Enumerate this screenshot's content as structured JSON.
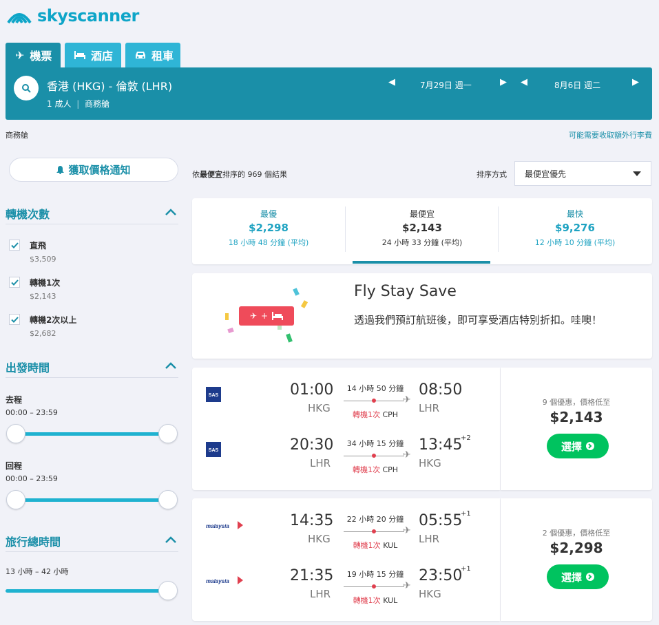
{
  "brand": {
    "name": "skyscanner"
  },
  "tabs": [
    {
      "label": "機票",
      "icon": "plane-icon"
    },
    {
      "label": "酒店",
      "icon": "bed-icon"
    },
    {
      "label": "租車",
      "icon": "car-icon"
    }
  ],
  "search": {
    "route": "香港 (HKG) - 倫敦 (LHR)",
    "passengers": "1 成人",
    "cabin": "商務艙",
    "depart_date": "7月29日 週一",
    "return_date": "8月6日 週二"
  },
  "subheader": {
    "cabin": "商務艙",
    "baggage_link": "可能需要收取額外行李費"
  },
  "sidebar": {
    "alert_button": "獲取價格通知",
    "stops": {
      "title": "轉機次數",
      "options": [
        {
          "label": "直飛",
          "price": "$3,509"
        },
        {
          "label": "轉機1次",
          "price": "$2,143"
        },
        {
          "label": "轉機2次以上",
          "price": "$2,682"
        }
      ]
    },
    "departure_time": {
      "title": "出發時間",
      "outbound_label": "去程",
      "outbound_range": "00:00 – 23:59",
      "return_label": "回程",
      "return_range": "00:00 – 23:59"
    },
    "duration": {
      "title": "旅行總時間",
      "range": "13 小時 – 42 小時"
    }
  },
  "results": {
    "count_prefix": "依",
    "count_bold": "最便宜",
    "count_suffix": "排序的 969 個結果",
    "sort_label": "排序方式",
    "sort_value": "最便宜優先"
  },
  "summary": [
    {
      "label": "最優",
      "price": "$2,298",
      "avg": "18 小時 48 分鐘 (平均)"
    },
    {
      "label": "最便宜",
      "price": "$2,143",
      "avg": "24 小時 33 分鐘 (平均)"
    },
    {
      "label": "最快",
      "price": "$9,276",
      "avg": "12 小時 10 分鐘 (平均)"
    }
  ],
  "promo": {
    "title": "Fly Stay Save",
    "text": "透過我們預訂航班後，即可享受酒店特別折扣。哇噢！",
    "badge_plus": "+"
  },
  "flights": [
    {
      "airline": "SAS",
      "legs": [
        {
          "dep_time": "01:00",
          "dep_code": "HKG",
          "duration": "14 小時 50 分鐘",
          "stops": "轉機1次",
          "via": "CPH",
          "arr_time": "08:50",
          "arr_code": "LHR",
          "plus": ""
        },
        {
          "dep_time": "20:30",
          "dep_code": "LHR",
          "duration": "34 小時 15 分鐘",
          "stops": "轉機1次",
          "via": "CPH",
          "arr_time": "13:45",
          "arr_code": "HKG",
          "plus": "+2"
        }
      ],
      "deals": "9 個優惠，價格低至",
      "price": "$2,143",
      "select": "選擇"
    },
    {
      "airline": "malaysia",
      "legs": [
        {
          "dep_time": "14:35",
          "dep_code": "HKG",
          "duration": "22 小時 20 分鐘",
          "stops": "轉機1次",
          "via": "KUL",
          "arr_time": "05:55",
          "arr_code": "LHR",
          "plus": "+1"
        },
        {
          "dep_time": "21:35",
          "dep_code": "LHR",
          "duration": "19 小時 15 分鐘",
          "stops": "轉機1次",
          "via": "KUL",
          "arr_time": "23:50",
          "arr_code": "HKG",
          "plus": "+1"
        }
      ],
      "deals": "2 個優惠，價格低至",
      "price": "$2,298",
      "select": "選擇"
    }
  ],
  "colors": {
    "brand": "#1a8fa8",
    "accent": "#1fb2d0",
    "select": "#00c35f",
    "stop": "#e0404f"
  }
}
